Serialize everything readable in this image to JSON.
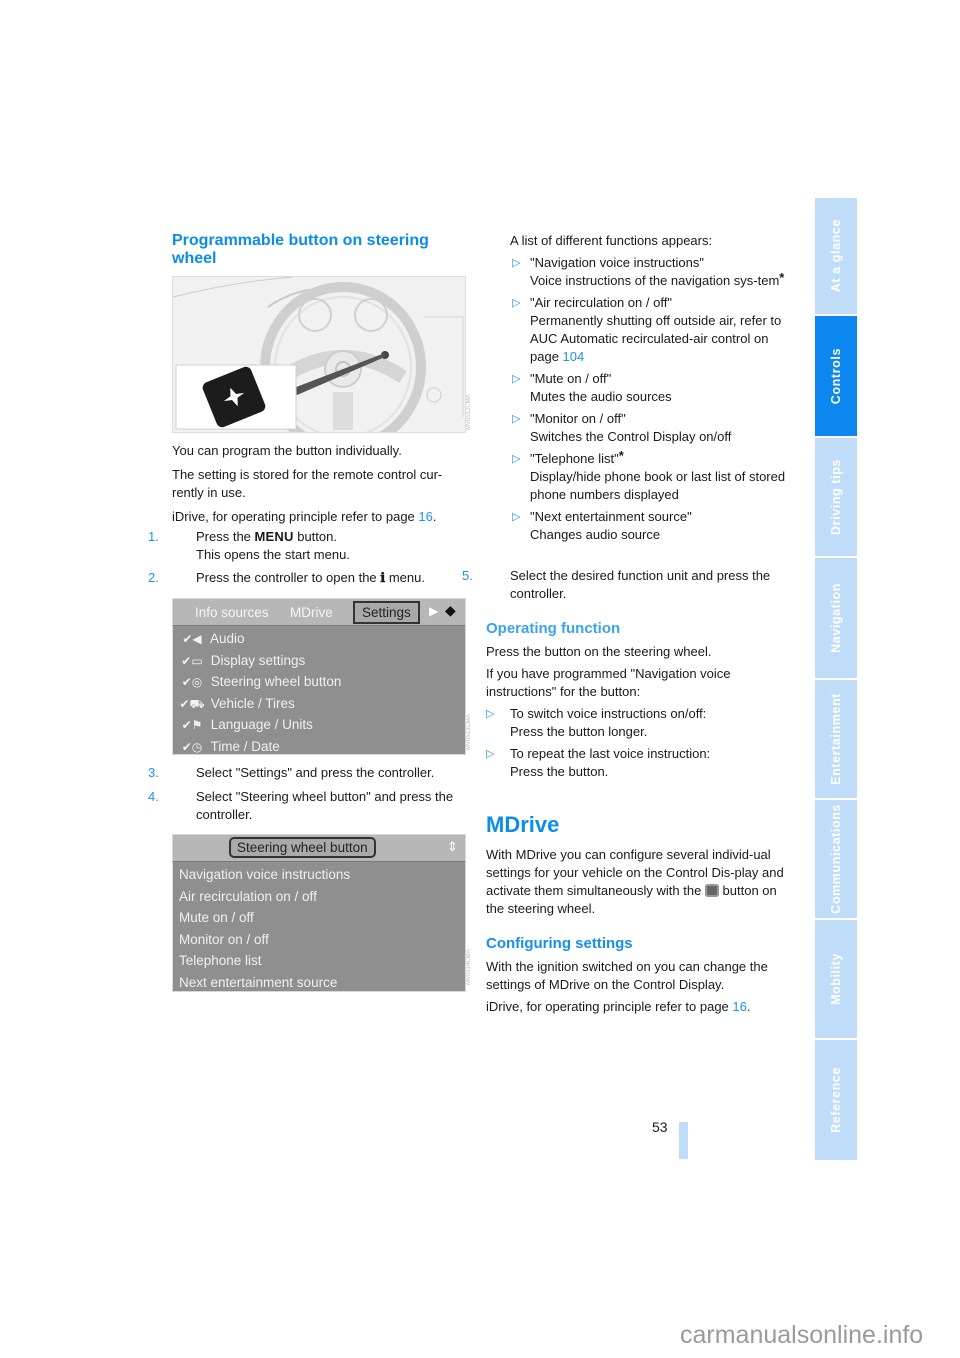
{
  "left_column": {
    "section_title": "Programmable button on steering wheel",
    "intro": [
      "You can program the button individually.",
      "The setting is stored for the remote control cur-rently in use."
    ],
    "idrive_ref": {
      "text": "iDrive, for operating principle refer to page ",
      "page": "16",
      "suffix": "."
    },
    "steps_a": [
      {
        "num": "1.",
        "pre": "Press the ",
        "key": "MENU",
        "post": " button.",
        "line2": "This opens the start menu."
      },
      {
        "num": "2.",
        "pre": "Press the controller to open the ",
        "icon": "info-i",
        "post": " menu."
      }
    ],
    "screen1": {
      "tabs": [
        "Info sources",
        "MDrive",
        "Settings"
      ],
      "selected_tab": "Settings",
      "items": [
        {
          "icon": "audio-icon",
          "glyph": "✔◀",
          "label": "Audio"
        },
        {
          "icon": "display-icon",
          "glyph": "✔▭",
          "label": "Display settings"
        },
        {
          "icon": "steering-wheel-icon",
          "glyph": "✔◎",
          "label": "Steering wheel button"
        },
        {
          "icon": "vehicle-icon",
          "glyph": "✔⛟",
          "label": "Vehicle / Tires"
        },
        {
          "icon": "flag-icon",
          "glyph": "✔⚑",
          "label": "Language / Units"
        },
        {
          "icon": "clock-icon",
          "glyph": "✔◷",
          "label": "Time / Date"
        }
      ]
    },
    "steps_b": [
      {
        "num": "3.",
        "text": "Select \"Settings\" and press the controller."
      },
      {
        "num": "4.",
        "text": "Select \"Steering wheel button\" and press the controller."
      }
    ],
    "screen2": {
      "title": "Steering wheel button",
      "items": [
        "Navigation voice instructions",
        "Air recirculation on / off",
        "Mute on / off",
        "Monitor on / off",
        "Telephone list",
        "Next entertainment source"
      ]
    }
  },
  "right_column": {
    "list_intro": "A list of different functions appears:",
    "functions": [
      {
        "name": "\"Navigation voice instructions\"",
        "desc": "Voice instructions of the navigation sys-tem",
        "star": true
      },
      {
        "name": "\"Air recirculation on / off\"",
        "desc": "Permanently shutting off outside air, refer to AUC Automatic recirculated-air control on page ",
        "page": "104"
      },
      {
        "name": "\"Mute on / off\"",
        "desc": "Mutes the audio sources"
      },
      {
        "name": "\"Monitor on / off\"",
        "desc": "Switches the Control Display on/off"
      },
      {
        "name": "\"Telephone list\"",
        "name_star": true,
        "desc": "Display/hide phone book or last list of stored phone numbers displayed"
      },
      {
        "name": "\"Next entertainment source\"",
        "desc": "Changes audio source"
      }
    ],
    "step5": {
      "num": "5.",
      "text": "Select the desired function unit and press the controller."
    },
    "operating_function": {
      "title": "Operating function",
      "p1": "Press the button on the steering wheel.",
      "p2": "If you have programmed \"Navigation voice instructions\" for the button:",
      "bullets": [
        {
          "l1": "To switch voice instructions on/off:",
          "l2": "Press the button longer."
        },
        {
          "l1": "To repeat the last voice instruction:",
          "l2": "Press the button."
        }
      ]
    },
    "mdrive": {
      "title": "MDrive",
      "p_pre": "With MDrive you can configure several individ-ual settings for your vehicle on the Control Dis-play and activate them simultaneously with the ",
      "p_post": " button on the steering wheel."
    },
    "configuring": {
      "title": "Configuring settings",
      "p1": "With the ignition switched on you can change the settings of MDrive on the Control Display.",
      "ref_text": "iDrive, for operating principle refer to page ",
      "ref_page": "16",
      "ref_suffix": "."
    }
  },
  "sidebar": {
    "tabs": [
      {
        "label": "At a glance",
        "active": false
      },
      {
        "label": "Controls",
        "active": true
      },
      {
        "label": "Driving tips",
        "active": false
      },
      {
        "label": "Navigation",
        "active": false
      },
      {
        "label": "Entertainment",
        "active": false
      },
      {
        "label": "Communications",
        "active": false
      },
      {
        "label": "Mobility",
        "active": false
      },
      {
        "label": "Reference",
        "active": false
      }
    ]
  },
  "page_number": "53",
  "watermark": "carmanualsonline.info",
  "colors": {
    "accent": "#0a8ee8",
    "tab_inactive": "#bfdcf9",
    "tab_active": "#0b87ef"
  }
}
